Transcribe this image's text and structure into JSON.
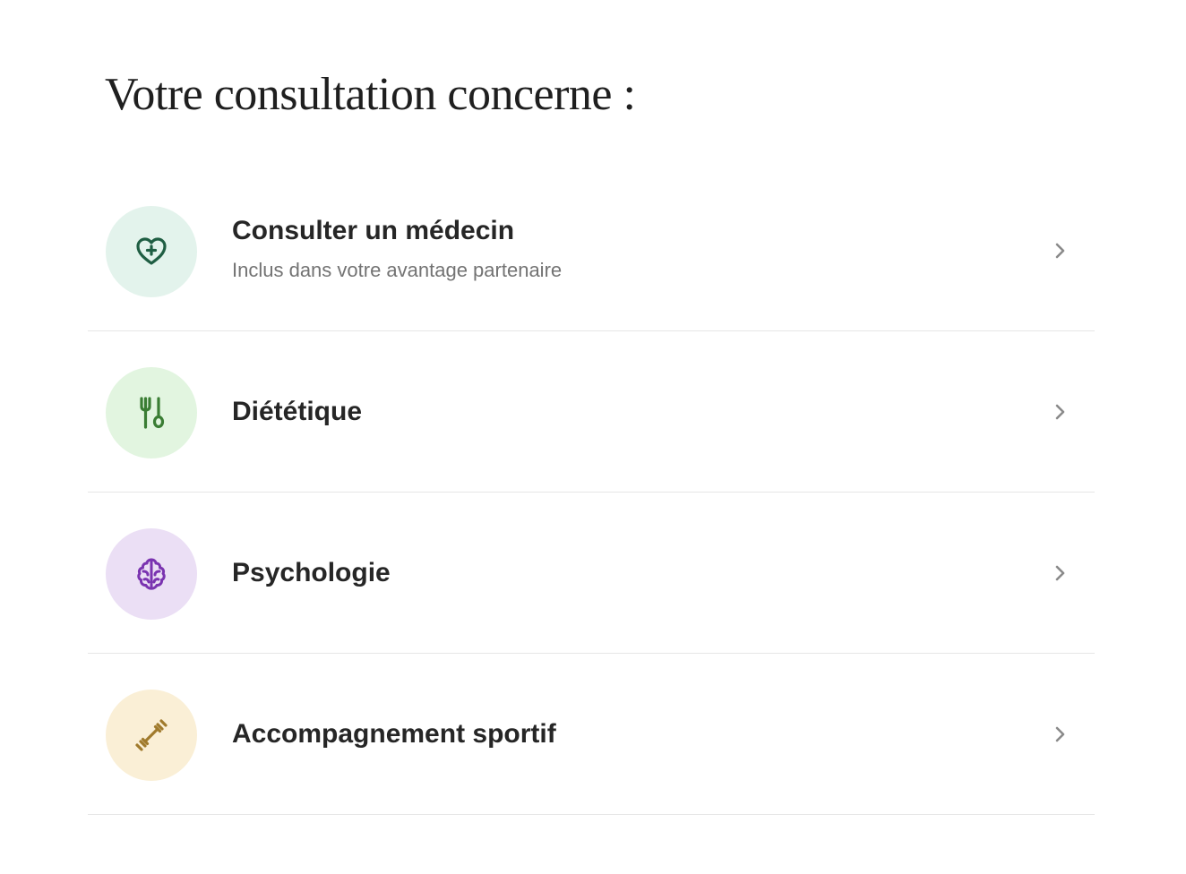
{
  "page": {
    "title": "Votre consultation concerne :"
  },
  "options": [
    {
      "title": "Consulter un médecin",
      "subtitle": "Inclus dans votre avantage partenaire",
      "icon": "heart-plus-icon",
      "icon_bg": "#e3f3ec",
      "icon_color": "#1f5e43"
    },
    {
      "title": "Diététique",
      "icon": "fork-spoon-icon",
      "icon_bg": "#e2f5e0",
      "icon_color": "#3a7d34"
    },
    {
      "title": "Psychologie",
      "icon": "brain-icon",
      "icon_bg": "#ebdff5",
      "icon_color": "#7a33b0"
    },
    {
      "title": "Accompagnement sportif",
      "icon": "dumbbell-icon",
      "icon_bg": "#faefd6",
      "icon_color": "#a07a2c"
    }
  ],
  "colors": {
    "divider": "#e6e6e6",
    "chevron": "#8a8a8a",
    "title_text": "#262626",
    "subtitle_text": "#737373"
  }
}
